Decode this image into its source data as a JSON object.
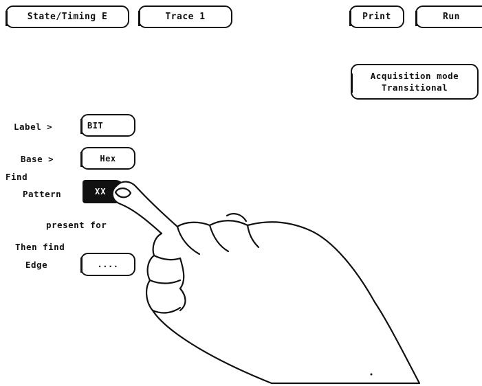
{
  "menu": {
    "state_timing_label": "State/Timing E",
    "trace_label": "Trace 1",
    "print_label": "Print",
    "run_label": "Run"
  },
  "acquisition": {
    "title": "Acquisition mode",
    "value": "Transitional"
  },
  "trigger": {
    "label_prompt": "Label >",
    "label_value": "BIT",
    "base_prompt": "Base >",
    "base_value": "Hex",
    "find_prompt": "Find",
    "pattern_prompt": "Pattern",
    "pattern_value": "XX",
    "present_for_prompt": "present for",
    "then_find_prompt": "Then find",
    "edge_prompt": "Edge",
    "edge_value": "...."
  },
  "icons": {
    "pointer": "pointing-hand-icon"
  }
}
